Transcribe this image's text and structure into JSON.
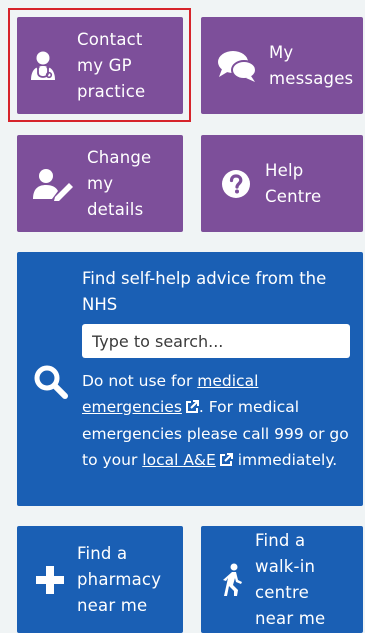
{
  "tiles": {
    "contact_gp": {
      "label": "Contact my GP practice",
      "icon": "doctor-icon"
    },
    "my_messages": {
      "label": "My messages",
      "icon": "speech-bubbles-icon"
    },
    "change_details": {
      "label": "Change my details",
      "icon": "user-edit-icon"
    },
    "help_centre": {
      "label": "Help Centre",
      "icon": "question-circle-icon"
    },
    "find_pharmacy": {
      "label": "Find a pharmacy near me",
      "icon": "plus-icon"
    },
    "find_walkin": {
      "label": "Find a walk-in centre near me",
      "icon": "walking-person-icon"
    }
  },
  "self_help": {
    "title": "Find self-help advice from the NHS",
    "search_placeholder": "Type to search...",
    "icon": "search-icon",
    "text_before_link1": "Do not use for ",
    "link1": "medical emergencies",
    "text_middle": ". For medical emergencies please call 999 or go to your ",
    "link2": "local A&E",
    "text_after_link2": " immediately."
  },
  "colors": {
    "purple": "#7d4f9a",
    "blue": "#1a5fb4",
    "highlight": "#d6242b",
    "background": "#f0f4f5"
  }
}
